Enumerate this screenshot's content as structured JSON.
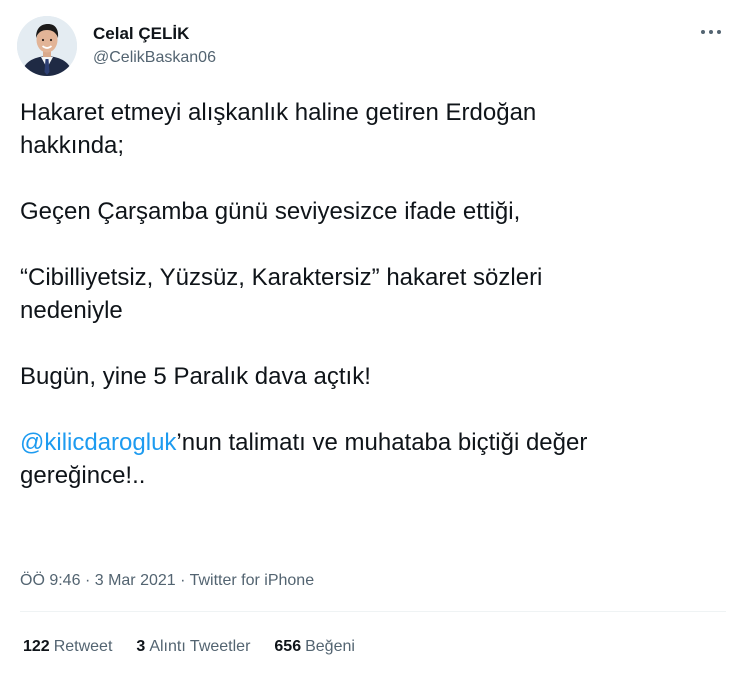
{
  "author": {
    "display_name": "Celal ÇELİK",
    "handle": "@CelikBaskan06",
    "avatar_icon": "profile-photo"
  },
  "more_icon": "ellipsis-icon",
  "tweet": {
    "line1": "Hakaret etmeyi alışkanlık haline getiren Erdoğan",
    "line2": "hakkında;",
    "line3": "Geçen Çarşamba günü seviyesizce ifade ettiği,",
    "line4": "“Cibilliyetsiz, Yüzsüz, Karaktersiz” hakaret sözleri",
    "line5": "nedeniyle",
    "line6": "Bugün, yine 5 Paralık dava açtık!",
    "mention": "@kilicdarogluk",
    "line7_rest": "’nun talimatı ve muhataba biçtiği değer",
    "line8": "gereğince!.."
  },
  "meta": {
    "time": "ÖÖ 9:46",
    "separator1": "·",
    "date": "3 Mar 2021",
    "separator2": "·",
    "source": "Twitter for iPhone"
  },
  "stats": {
    "retweets": {
      "count": "122",
      "label": "Retweet"
    },
    "quotes": {
      "count": "3",
      "label": "Alıntı Tweetler"
    },
    "likes": {
      "count": "656",
      "label": "Beğeni"
    }
  },
  "colors": {
    "link": "#1d9bf0",
    "text": "#0f1419",
    "secondary": "#536471"
  }
}
